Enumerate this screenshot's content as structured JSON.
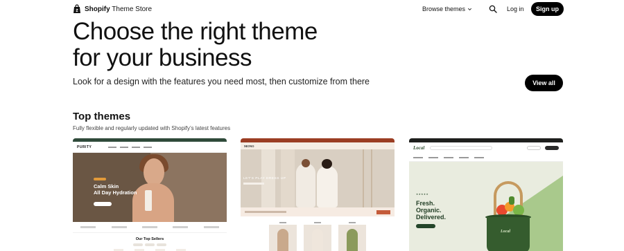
{
  "nav": {
    "brand_bold": "Shopify",
    "brand_rest": " Theme Store",
    "browse_label": "Browse themes",
    "login_label": "Log in",
    "signup_label": "Sign up"
  },
  "hero": {
    "title_line1": "Choose the right theme",
    "title_line2": "for your business",
    "subtitle": "Look for a design with the features you need most, then customize from there",
    "view_all_label": "View all"
  },
  "top_themes": {
    "title": "Top themes",
    "subtitle": "Fully flexible and regularly updated with Shopify’s latest features",
    "cards": [
      {
        "logo": "PURITY",
        "hero_line1": "Calm Skin",
        "hero_line2": "All Day Hydration",
        "section_title": "Our Top Sellers"
      },
      {
        "logo": "MONO",
        "hero_text": "LET'S PLAY DRESS UP"
      },
      {
        "logo": "Local",
        "stars": "★★★★★",
        "hero_line1": "Fresh.",
        "hero_line2": "Organic.",
        "hero_line3": "Delivered.",
        "basket_label": "Local"
      }
    ]
  },
  "colors": {
    "primary_button": "#000000",
    "card1_accent": "#2f4a3a",
    "card2_accent": "#9b3d23",
    "card3_accent": "#355c2e"
  },
  "icons": {
    "brand": "shopify-bag-icon",
    "browse": "chevron-down-icon",
    "search": "search-icon"
  }
}
